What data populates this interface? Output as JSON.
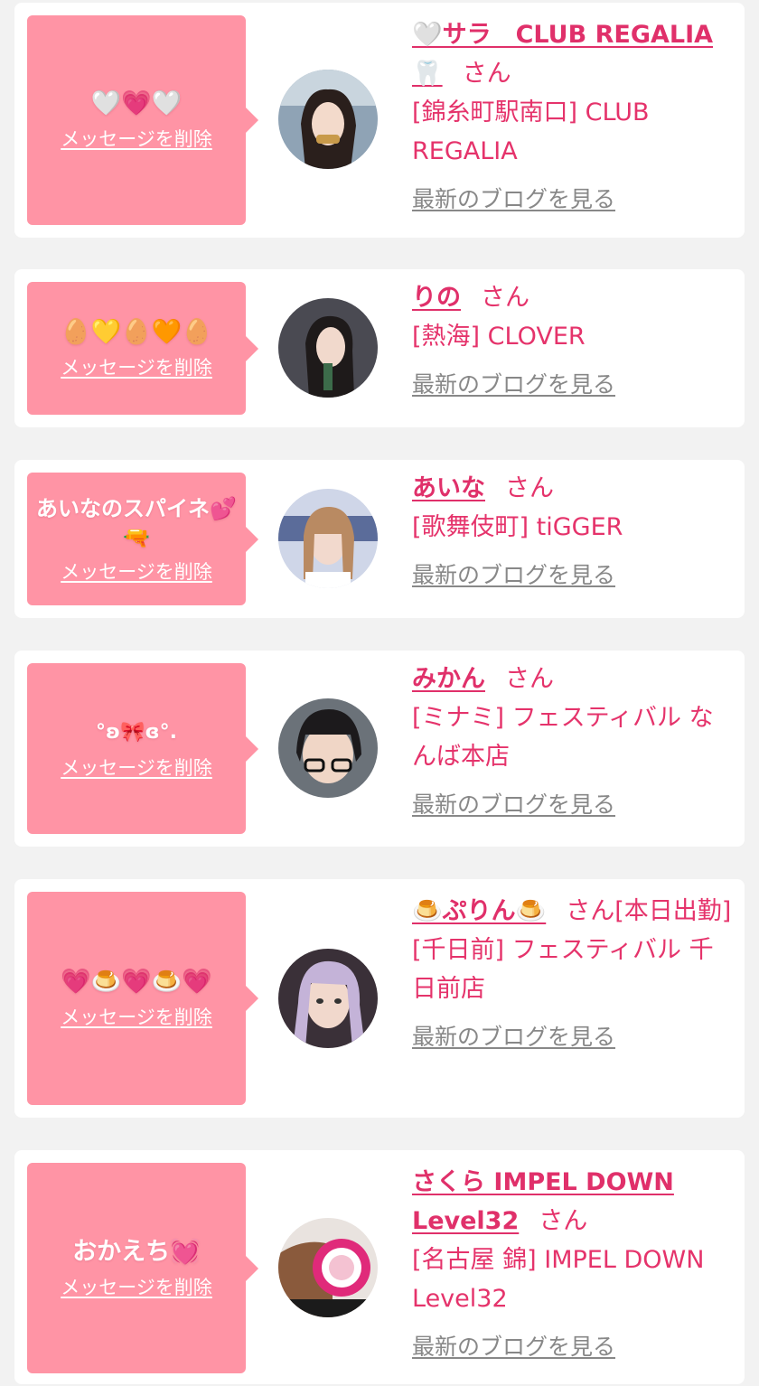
{
  "colors": {
    "accent": "#e5336b",
    "bubble": "#ff94a5",
    "background": "#f2f2f2",
    "link_gray": "#888888"
  },
  "delete_label": "メッセージを削除",
  "blog_label": "最新のブログを見る",
  "san_label": "さん",
  "items": [
    {
      "message": "🤍💗🤍",
      "name": "🤍サラ　CLUB REGALIA🦷",
      "shop": "[錦糸町駅南口] CLUB REGALIA"
    },
    {
      "message": "🥚💛🥚🧡🥚",
      "name": "りの",
      "shop": "[熱海] CLOVER"
    },
    {
      "message": "あいなのスパイネ💕🔫",
      "name": "あいな",
      "shop": "[歌舞伎町] tiGGER"
    },
    {
      "message": "°ʚ🎀ɞ°.",
      "name": "みかん",
      "shop": "[ミナミ] フェスティバル なんば本店"
    },
    {
      "message": "💗🍮💗🍮💗",
      "name": "🍮ぷりん🍮",
      "suffix": "[本日出勤]",
      "shop": "[千日前] フェスティバル 千日前店"
    },
    {
      "message": "おかえち💓",
      "name": "さくら IMPEL DOWN Level32",
      "shop": "[名古屋 錦] IMPEL DOWN Level32"
    }
  ]
}
